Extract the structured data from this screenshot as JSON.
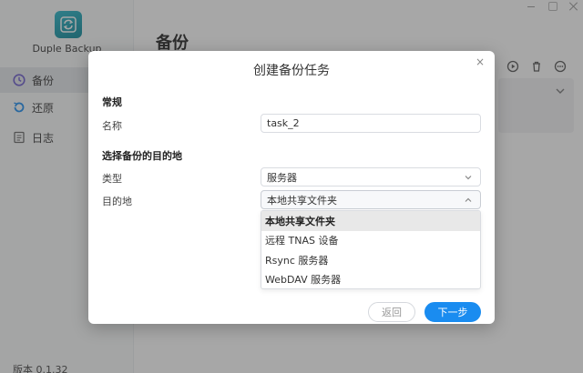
{
  "app": {
    "name": "Duple Backup",
    "version": "版本 0.1.32"
  },
  "sidebar": {
    "items": [
      {
        "label": "备份",
        "icon": "clock-icon"
      },
      {
        "label": "还原",
        "icon": "restore-icon"
      },
      {
        "label": "日志",
        "icon": "log-icon"
      }
    ]
  },
  "main": {
    "title": "备份"
  },
  "dialog": {
    "title": "创建备份任务",
    "general_section": "常规",
    "name_label": "名称",
    "name_value": "task_2",
    "destination_section": "选择备份的目的地",
    "type_label": "类型",
    "type_value": "服务器",
    "destination_label": "目的地",
    "destination_value": "本地共享文件夹",
    "options": [
      {
        "label": "本地共享文件夹"
      },
      {
        "label": "远程 TNAS 设备"
      },
      {
        "label": "Rsync 服务器"
      },
      {
        "label": "WebDAV 服务器"
      }
    ],
    "back_label": "返回",
    "next_label": "下一步",
    "close_glyph": "×"
  },
  "colors": {
    "accent": "#1a8cf0",
    "logo": "#17a2b4"
  }
}
